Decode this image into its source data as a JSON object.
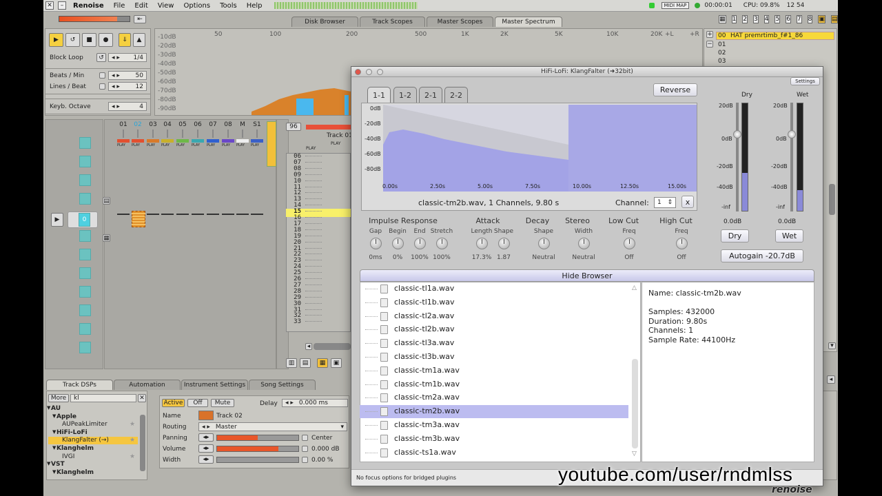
{
  "menubar": {
    "app": "Renoise",
    "items": [
      "File",
      "Edit",
      "View",
      "Options",
      "Tools",
      "Help"
    ],
    "midi_map": "MIDI MAP",
    "time": "00:00:01",
    "cpu": "CPU: 09.8%",
    "clock": "12 54"
  },
  "top_tabs": [
    "Disk Browser",
    "Track Scopes",
    "Master Scopes",
    "Master Spectrum"
  ],
  "transport": {
    "block_loop": "Block Loop",
    "block_value": "1/4",
    "beats_label": "Beats / Min",
    "beats_value": "50",
    "lines_label": "Lines / Beat",
    "lines_value": "12",
    "octave_label": "Keyb. Octave",
    "octave_value": "4"
  },
  "spectrum": {
    "db_labels": [
      "-10dB",
      "-20dB",
      "-30dB",
      "-40dB",
      "-50dB",
      "-60dB",
      "-70dB",
      "-80dB",
      "-90dB"
    ],
    "freq_labels": [
      "50",
      "100",
      "200",
      "500",
      "1K",
      "2K",
      "5K",
      "10K",
      "20K"
    ],
    "left": "+L",
    "right": "+R"
  },
  "instrument": {
    "slot": "00",
    "name": "HAT premrtimb_f#1_86",
    "rows": [
      "01",
      "02",
      "03"
    ]
  },
  "tracks": {
    "labels": [
      "01",
      "02",
      "03",
      "04",
      "05",
      "06",
      "07",
      "08",
      "M",
      "S1"
    ],
    "play": "PLAY",
    "track_name": "Track 01",
    "pattern": "96",
    "current": "0"
  },
  "pattern_rows": [
    "06",
    "07",
    "08",
    "09",
    "10",
    "11",
    "12",
    "13",
    "14",
    "15",
    "16",
    "17",
    "18",
    "19",
    "20",
    "21",
    "22",
    "23",
    "24",
    "25",
    "26",
    "27",
    "28",
    "29",
    "30",
    "31",
    "32",
    "33"
  ],
  "bottom_tabs": [
    "Track DSPs",
    "Automation",
    "Instrument Settings",
    "Song Settings"
  ],
  "dsp_browser": {
    "more": "More",
    "search": "kl",
    "items": [
      {
        "t": "AU",
        "lvl": 0
      },
      {
        "t": "Apple",
        "lvl": 1
      },
      {
        "t": "AUPeakLimiter",
        "lvl": 2
      },
      {
        "t": "HiFi-LoFi",
        "lvl": 1
      },
      {
        "t": "KlangFalter (→)",
        "lvl": 2,
        "sel": true
      },
      {
        "t": "Klanghelm",
        "lvl": 1
      },
      {
        "t": "IVGI",
        "lvl": 2
      },
      {
        "t": "VST",
        "lvl": 0
      },
      {
        "t": "Klanghelm",
        "lvl": 1
      }
    ]
  },
  "track_props": {
    "active": "Active",
    "off": "Off",
    "mute": "Mute",
    "delay_label": "Delay",
    "delay_value": "0.000 ms",
    "name_label": "Name",
    "name_value": "Track 02",
    "routing_label": "Routing",
    "routing_value": "Master",
    "panning_label": "Panning",
    "panning_value": "Center",
    "volume_label": "Volume",
    "volume_value": "0.000 dB",
    "width_label": "Width",
    "width_value": "0.00 %",
    "panning_fill": 0.5,
    "volume_fill": 0.75,
    "width_fill": 0.0
  },
  "plugin": {
    "title": "HiFi-LoFi: KlangFalter (➜32bit)",
    "settings": "Settings",
    "reverse": "Reverse",
    "tabs": [
      "1-1",
      "1-2",
      "2-1",
      "2-2"
    ],
    "ir_db": [
      "0dB",
      "-20dB",
      "-40dB",
      "-60dB",
      "-80dB"
    ],
    "ir_time": [
      "0.00s",
      "2.50s",
      "5.00s",
      "7.50s",
      "10.00s",
      "12.50s",
      "15.00s"
    ],
    "file_info": "classic-tm2b.wav, 1 Channels, 9.80 s",
    "channel_label": "Channel:",
    "channel_value": "1",
    "channel_x": "x",
    "sections": {
      "impulse": "Impulse Response",
      "attack": "Attack",
      "decay": "Decay",
      "stereo": "Stereo",
      "lowcut": "Low Cut",
      "highcut": "High Cut"
    },
    "knobs": [
      {
        "label": "Gap",
        "value": "0ms"
      },
      {
        "label": "Begin",
        "value": "0%"
      },
      {
        "label": "End",
        "value": "100%"
      },
      {
        "label": "Stretch",
        "value": "100%"
      },
      {
        "label": "Length",
        "value": "17.3%"
      },
      {
        "label": "Shape",
        "value": "1.87"
      },
      {
        "label": "Shape",
        "value": "Neutral"
      },
      {
        "label": "Width",
        "value": "Neutral"
      },
      {
        "label": "Freq",
        "value": "Off"
      },
      {
        "label": "Freq",
        "value": "Off"
      }
    ],
    "dry_label": "Dry",
    "wet_label": "Wet",
    "meter_scale": [
      "20dB",
      "0dB",
      "-20dB",
      "-40dB",
      "-inf"
    ],
    "dry_db": "0.0dB",
    "wet_db": "0.0dB",
    "dry_btn": "Dry",
    "wet_btn": "Wet",
    "autogain": "Autogain -20.7dB",
    "hide_browser": "Hide Browser",
    "files": [
      "classic-tl1a.wav",
      "classic-tl1b.wav",
      "classic-tl2a.wav",
      "classic-tl2b.wav",
      "classic-tl3a.wav",
      "classic-tl3b.wav",
      "classic-tm1a.wav",
      "classic-tm1b.wav",
      "classic-tm2a.wav",
      "classic-tm2b.wav",
      "classic-tm3a.wav",
      "classic-tm3b.wav",
      "classic-ts1a.wav"
    ],
    "selected_file": "classic-tm2b.wav",
    "info": {
      "name": "Name: classic-tm2b.wav",
      "samples": "Samples: 432000",
      "duration": "Duration: 9.80s",
      "channels": "Channels: 1",
      "rate": "Sample Rate: 44100Hz"
    },
    "status": "No focus options for bridged plugins"
  },
  "watermark": "youtube.com/user/rndmlss",
  "logo": "renoise"
}
